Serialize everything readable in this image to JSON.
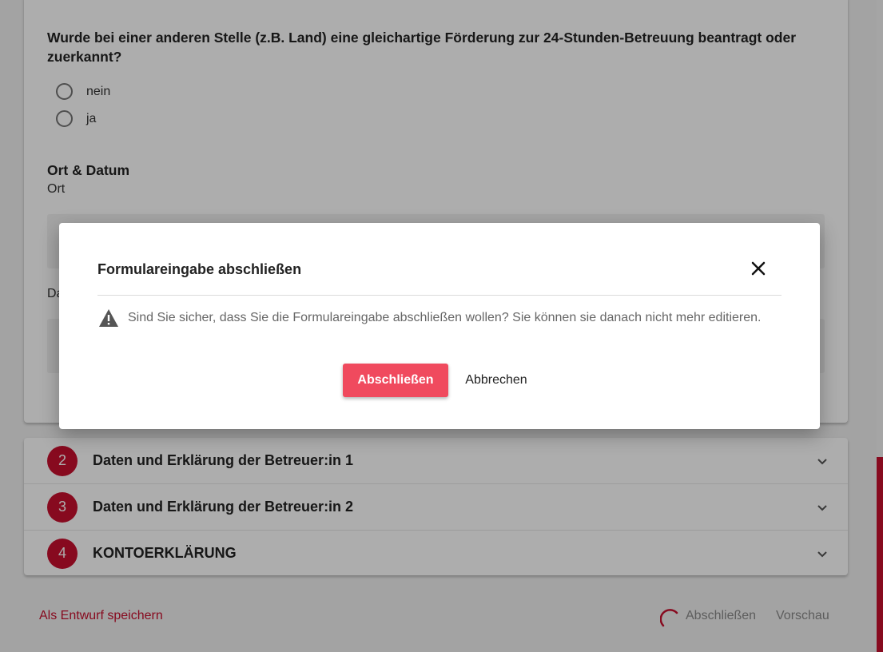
{
  "form": {
    "question": "Wurde bei einer anderen Stelle (z.B. Land) eine gleichartige Förderung zur 24-Stunden-Betreuung beantragt oder zuerkannt?",
    "options": [
      "nein",
      "ja"
    ],
    "section_title": "Ort & Datum",
    "field_ort": "Ort",
    "field_datum_partial": "Da"
  },
  "accordion": [
    {
      "number": "2",
      "title": "Daten und Erklärung der Betreuer:in 1"
    },
    {
      "number": "3",
      "title": "Daten und Erklärung der Betreuer:in 2"
    },
    {
      "number": "4",
      "title": "KONTOERKLÄRUNG"
    }
  ],
  "bottom_bar": {
    "draft_label": "Als Entwurf speichern",
    "finish_label": "Abschließen",
    "preview_label": "Vorschau"
  },
  "modal": {
    "title": "Formulareingabe abschließen",
    "message": "Sind Sie sicher, dass Sie die Formulareingabe abschließen wollen? Sie können sie danach nicht mehr editieren.",
    "confirm_label": "Abschließen",
    "cancel_label": "Abbrechen"
  },
  "icons": {
    "close": "close-icon",
    "warning": "warning-icon",
    "chevron": "chevron-down-icon",
    "spinner": "loading-spinner-icon"
  },
  "colors": {
    "brand_red": "#c8102e",
    "confirm_button": "#f04a5e"
  }
}
